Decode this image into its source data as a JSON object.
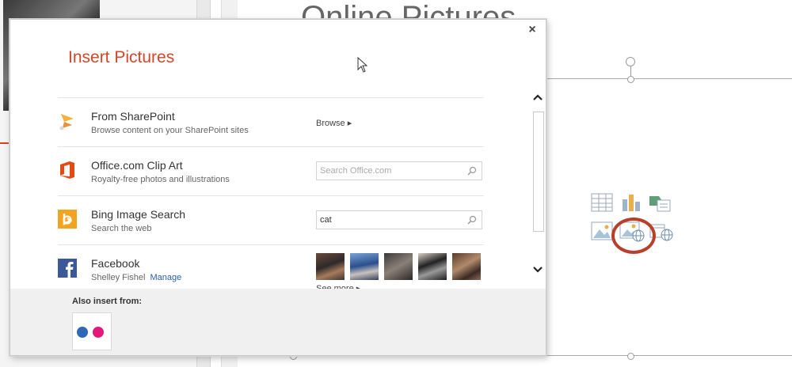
{
  "slide": {
    "title": "Online Pictures",
    "placeholder_icons": [
      "table-icon",
      "chart-icon",
      "smartart-icon",
      "pictures-icon",
      "online-pictures-icon",
      "video-icon"
    ],
    "highlight_color": "#b6402a"
  },
  "dialog": {
    "title": "Insert Pictures",
    "close_label": "×",
    "accent_color": "#d24726",
    "sources": [
      {
        "icon": "sharepoint-icon",
        "title": "From SharePoint",
        "subtitle": "Browse content on your SharePoint sites",
        "action_label": "Browse ▸"
      },
      {
        "icon": "office-icon",
        "title": "Office.com Clip Art",
        "subtitle": "Royalty-free photos and illustrations",
        "search_placeholder": "Search Office.com",
        "search_value": ""
      },
      {
        "icon": "bing-icon",
        "title": "Bing Image Search",
        "subtitle": "Search the web",
        "search_placeholder": "",
        "search_value": "cat"
      },
      {
        "icon": "facebook-icon",
        "title": "Facebook",
        "subtitle": "Shelley Fishel",
        "manage_label": "Manage",
        "see_more_label": "See more ▸",
        "photo_count": 5
      }
    ],
    "also_insert_label": "Also insert from:",
    "also_insert_items": [
      "flickr-icon"
    ]
  }
}
